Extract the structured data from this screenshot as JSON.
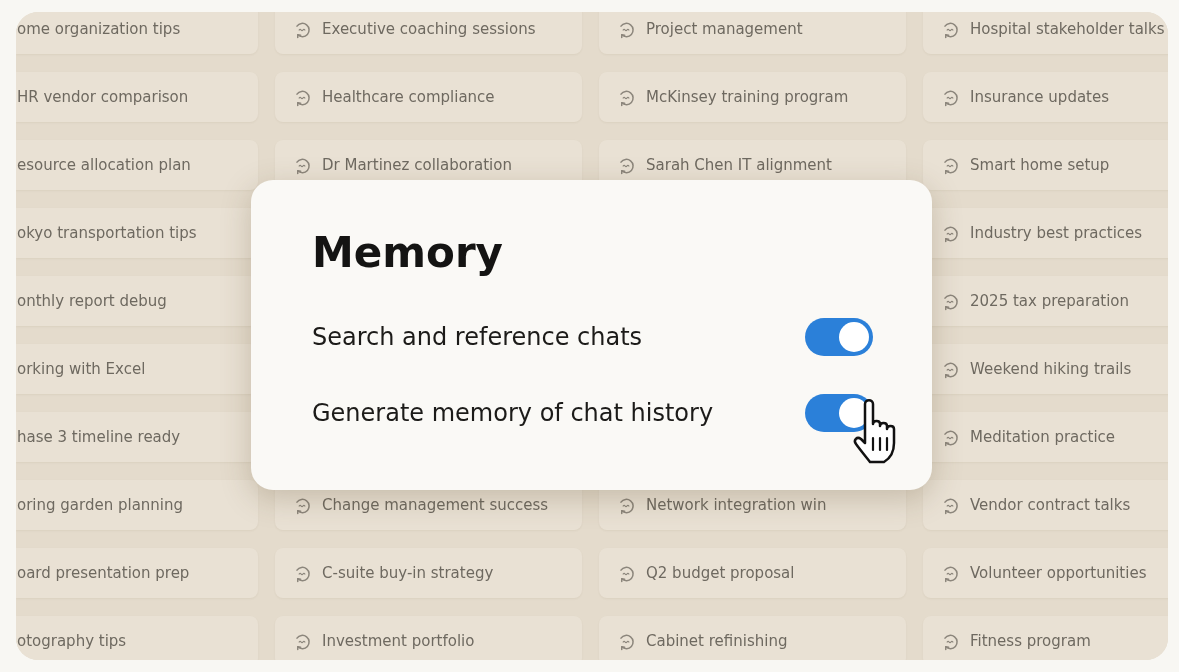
{
  "chats": [
    [
      {
        "kind": "cut",
        "label": "ome organization tips"
      },
      {
        "kind": "chat",
        "label": "Executive coaching sessions"
      },
      {
        "kind": "chat",
        "label": "Project management"
      },
      {
        "kind": "chat",
        "label": "Hospital stakeholder talks"
      }
    ],
    [
      {
        "kind": "cut",
        "label": "HR vendor comparison"
      },
      {
        "kind": "chat",
        "label": "Healthcare compliance"
      },
      {
        "kind": "chat",
        "label": "McKinsey training program"
      },
      {
        "kind": "chat",
        "label": "Insurance updates"
      }
    ],
    [
      {
        "kind": "cut",
        "label": "esource allocation plan"
      },
      {
        "kind": "chat",
        "label": "Dr Martinez collaboration"
      },
      {
        "kind": "chat",
        "label": "Sarah Chen IT alignment"
      },
      {
        "kind": "chat",
        "label": "Smart home setup"
      }
    ],
    [
      {
        "kind": "cut",
        "label": "okyo transportation tips"
      },
      {
        "kind": "chat",
        "label": "Industry best practices"
      }
    ],
    [
      {
        "kind": "cut",
        "label": "onthly report debug"
      },
      {
        "kind": "chat",
        "label": "2025 tax preparation"
      }
    ],
    [
      {
        "kind": "cut",
        "label": "orking with Excel"
      },
      {
        "kind": "chat",
        "label": "Weekend hiking trails"
      }
    ],
    [
      {
        "kind": "cut",
        "label": "hase 3 timeline ready"
      },
      {
        "kind": "chat",
        "label": "Meditation practice"
      }
    ],
    [
      {
        "kind": "cut",
        "label": "oring garden planning"
      },
      {
        "kind": "chat",
        "label": "Change management success"
      },
      {
        "kind": "chat",
        "label": "Network integration win"
      },
      {
        "kind": "chat",
        "label": "Vendor contract talks"
      }
    ],
    [
      {
        "kind": "cut",
        "label": "oard presentation prep"
      },
      {
        "kind": "chat",
        "label": "C-suite buy-in strategy"
      },
      {
        "kind": "chat",
        "label": "Q2 budget proposal"
      },
      {
        "kind": "chat",
        "label": "Volunteer opportunities"
      }
    ],
    [
      {
        "kind": "cut",
        "label": "otography tips"
      },
      {
        "kind": "chat",
        "label": "Investment portfolio"
      },
      {
        "kind": "chat",
        "label": "Cabinet refinishing"
      },
      {
        "kind": "chat",
        "label": "Fitness program"
      }
    ]
  ],
  "dialog": {
    "title": "Memory",
    "settings": [
      {
        "label": "Search and reference chats",
        "on": true
      },
      {
        "label": "Generate memory of chat history",
        "on": true
      }
    ]
  }
}
